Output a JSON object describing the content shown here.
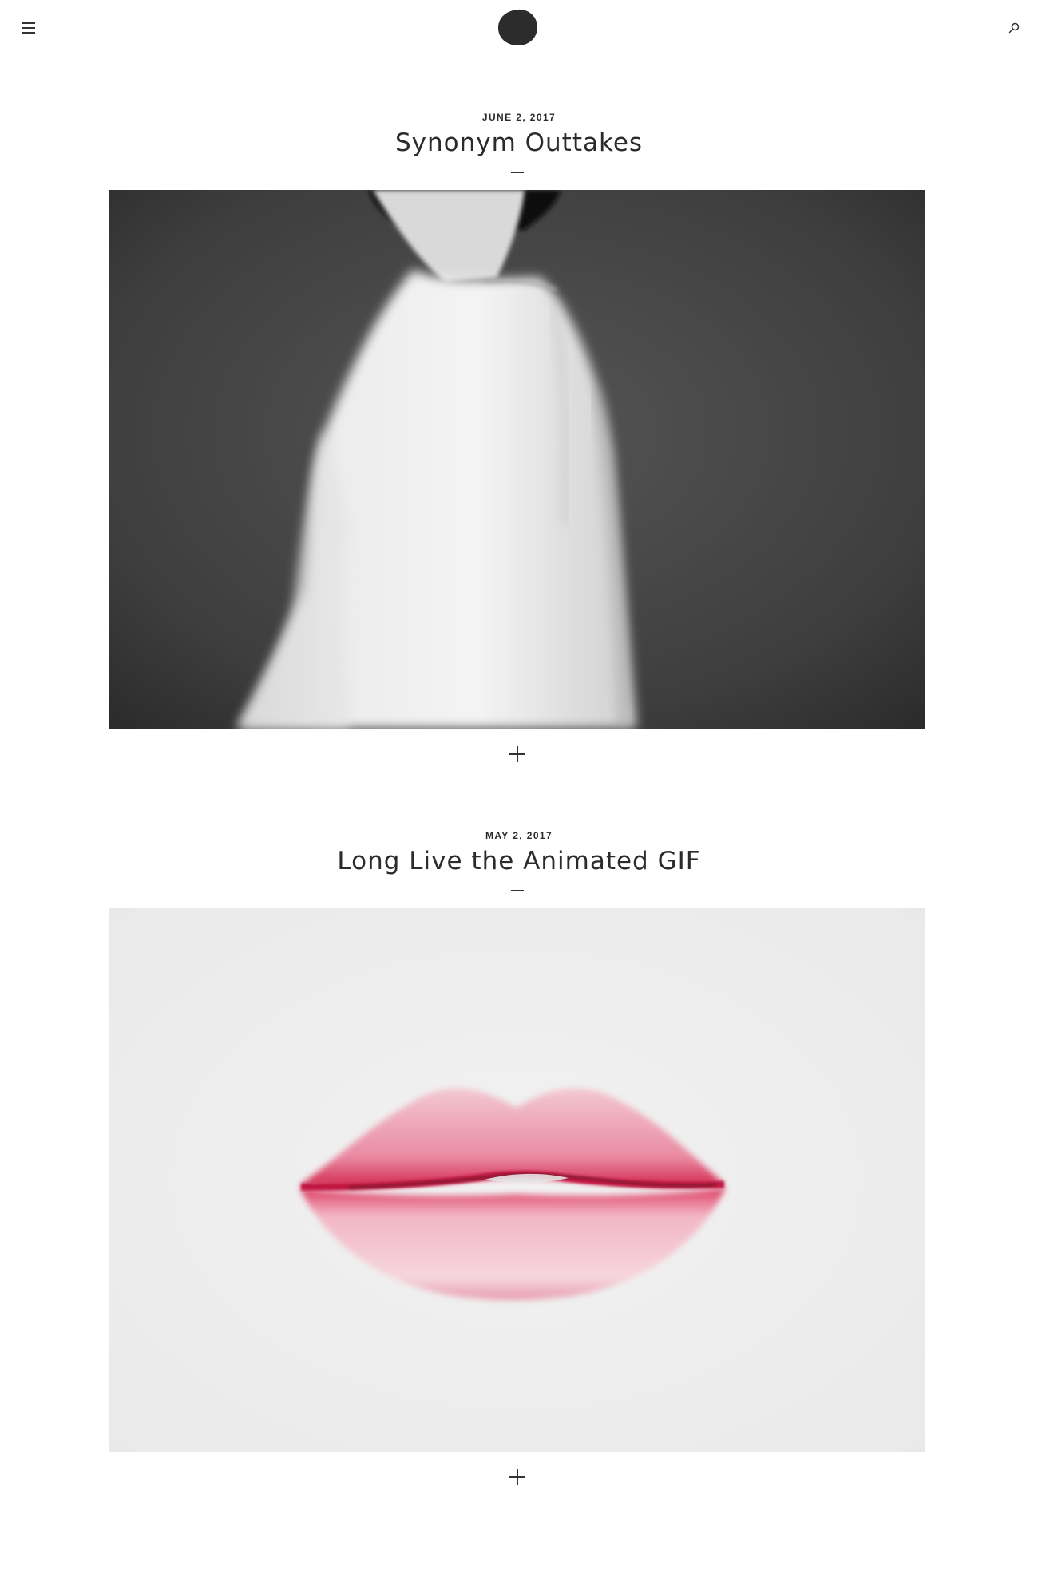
{
  "header": {
    "menu_icon": "hamburger-menu-icon",
    "logo_icon": "circle-logo-icon",
    "search_icon": "search-icon",
    "logo_color": "#2c2c2c"
  },
  "posts": [
    {
      "date": "JUNE 2, 2017",
      "title": "Synonym Outtakes",
      "image_subject": "black-and-white photo of a person in a white shirt, motion blurred",
      "more_icon": "plus-icon"
    },
    {
      "date": "MAY 2, 2017",
      "title": "Long Live the Animated GIF",
      "image_subject": "drawing of red lips on white paper",
      "more_icon": "plus-icon"
    }
  ]
}
